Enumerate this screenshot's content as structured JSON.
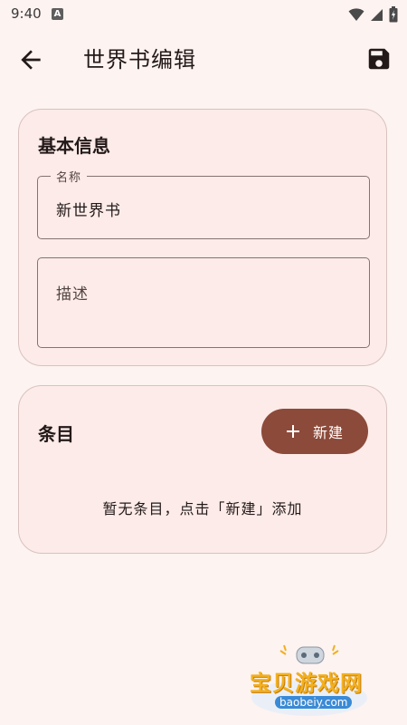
{
  "status_bar": {
    "time": "9:40",
    "notification_icon": "A"
  },
  "app_bar": {
    "title": "世界书编辑",
    "back_icon": "arrow-back-icon",
    "save_icon": "save-icon"
  },
  "basic_info": {
    "title": "基本信息",
    "name_field": {
      "label": "名称",
      "value": "新世界书"
    },
    "description_field": {
      "placeholder": "描述",
      "value": ""
    }
  },
  "entries": {
    "title": "条目",
    "new_button_label": "新建",
    "empty_hint": "暂无条目，点击「新建」添加"
  },
  "watermark": {
    "text": "宝贝游戏网",
    "url": "baobeiy.com"
  },
  "colors": {
    "background": "#fdf3f1",
    "card": "#fcebe8",
    "accent": "#8c4a3a"
  }
}
